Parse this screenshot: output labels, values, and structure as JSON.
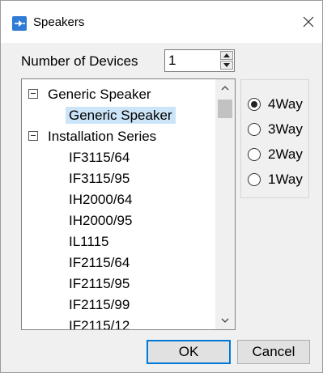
{
  "window": {
    "title": "Speakers",
    "app_icon": "speaker-app-icon",
    "close_icon": "close-icon"
  },
  "device_count": {
    "label": "Number of Devices",
    "value": "1"
  },
  "tree": {
    "groups": [
      {
        "label": "Generic Speaker",
        "expanded": true,
        "items": [
          "Generic Speaker"
        ]
      },
      {
        "label": "Installation Series",
        "expanded": true,
        "items": [
          "IF3115/64",
          "IF3115/95",
          "IH2000/64",
          "IH2000/95",
          "IL1115",
          "IF2115/64",
          "IF2115/95",
          "IF2115/99"
        ]
      }
    ],
    "selected_item": "Generic Speaker"
  },
  "way_options": {
    "options": [
      "4Way",
      "3Way",
      "2Way",
      "1Way"
    ],
    "selected": "4Way"
  },
  "buttons": {
    "ok": "OK",
    "cancel": "Cancel"
  },
  "colors": {
    "accent": "#0078d7",
    "selection": "#cce4f7",
    "icon_blue": "#2f7bd6"
  }
}
